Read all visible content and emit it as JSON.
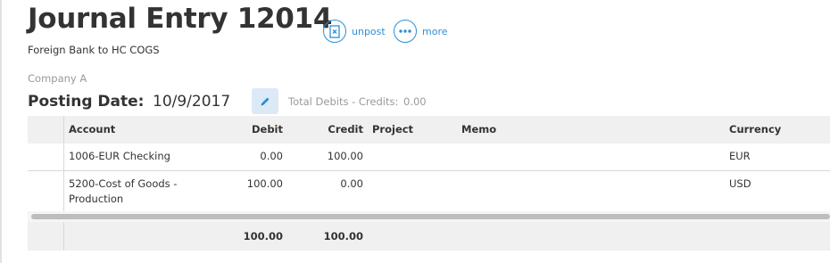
{
  "header": {
    "title": "Journal Entry 12014",
    "subtitle": "Foreign Bank to HC COGS"
  },
  "actions": {
    "unpost_label": "unpost",
    "more_label": "more"
  },
  "company": "Company A",
  "posting": {
    "label": "Posting Date:",
    "date": "10/9/2017",
    "totals_label": "Total Debits - Credits:",
    "totals_value": "0.00"
  },
  "table": {
    "columns": {
      "account": "Account",
      "debit": "Debit",
      "credit": "Credit",
      "project": "Project",
      "memo": "Memo",
      "currency": "Currency"
    },
    "rows": [
      {
        "account": "1006-EUR Checking",
        "account_line2": "",
        "debit": "0.00",
        "credit": "100.00",
        "project": "",
        "memo": "",
        "currency": "EUR"
      },
      {
        "account": "5200-Cost of Goods -",
        "account_line2": "Production",
        "debit": "100.00",
        "credit": "0.00",
        "project": "",
        "memo": "",
        "currency": "USD"
      }
    ],
    "totals": {
      "debit": "100.00",
      "credit": "100.00"
    }
  },
  "colors": {
    "accent": "#2d8fd5",
    "header_bg": "#f0f0f0",
    "edit_bg": "#dce9f6"
  },
  "icons": {
    "unpost": "document-x-icon",
    "more": "ellipsis-icon",
    "edit": "pencil-icon"
  }
}
